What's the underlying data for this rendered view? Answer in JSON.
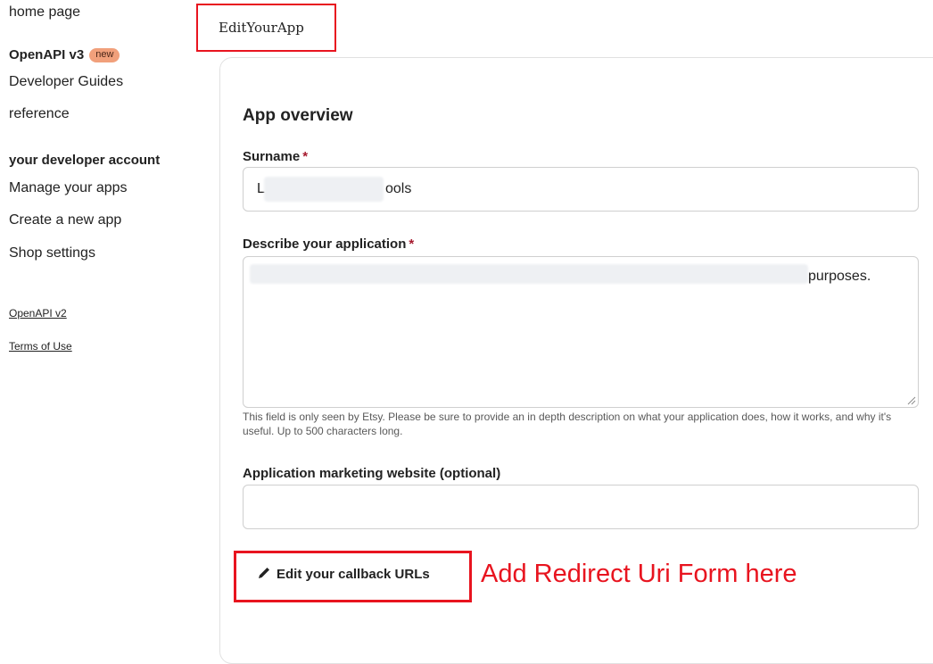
{
  "sidebar": {
    "home": "home page",
    "openapi_v3": "OpenAPI v3",
    "new_badge": "new",
    "developer_guides": "Developer Guides",
    "reference": "reference",
    "account_heading": "your developer account",
    "manage_apps": "Manage your apps",
    "create_app": "Create a new app",
    "shop_settings": "Shop settings",
    "openapi_v2": "OpenAPI v2",
    "terms": "Terms of Use"
  },
  "page": {
    "title": "EditYourApp"
  },
  "form": {
    "section_title": "App overview",
    "required_mark": "*",
    "surname": {
      "label": "Surname",
      "value_start": "L",
      "value_end": "ools"
    },
    "description": {
      "label": "Describe your application",
      "value_end": "purposes.",
      "help": "This field is only seen by Etsy. Please be sure to provide an in depth description on what your application does, how it works, and why it's useful. Up to 500 characters long."
    },
    "website": {
      "label": "Application marketing website (optional)",
      "value": ""
    },
    "callback_button": "Edit your callback URLs",
    "annotation": "Add Redirect Uri Form here"
  },
  "icons": {
    "pencil": "pencil-icon",
    "resize": "resize-grip-icon"
  },
  "colors": {
    "highlight": "#e8141f",
    "badge": "#f1a07b",
    "required": "#a61a2e"
  }
}
